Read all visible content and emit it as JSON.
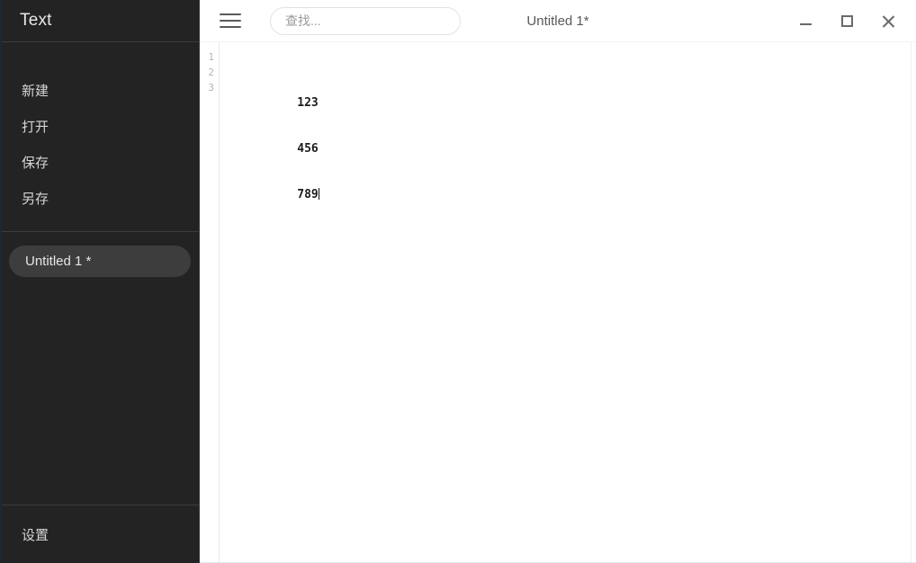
{
  "sidebar": {
    "app_title": "Text",
    "menu_items": [
      {
        "label": "新建",
        "name": "menu-item-new"
      },
      {
        "label": "打开",
        "name": "menu-item-open"
      },
      {
        "label": "保存",
        "name": "menu-item-save"
      },
      {
        "label": "另存",
        "name": "menu-item-save-as"
      }
    ],
    "tabs": [
      {
        "label": "Untitled 1 *",
        "active": true
      }
    ],
    "settings_label": "设置",
    "colors": {
      "background": "#232323",
      "divider": "#3c3c3c",
      "active_tab_background": "#3d3d3d",
      "text": "#d6d6d6"
    }
  },
  "topbar": {
    "menu_icon": "hamburger-icon",
    "search": {
      "placeholder": "查找...",
      "value": ""
    },
    "window_title": "Untitled 1*",
    "window_controls": [
      {
        "name": "minimize-button",
        "icon": "minimize-icon",
        "label": "—"
      },
      {
        "name": "maximize-button",
        "icon": "maximize-icon",
        "label": "□"
      },
      {
        "name": "close-button",
        "icon": "close-icon",
        "label": "✕"
      }
    ]
  },
  "editor": {
    "line_numbers": [
      "1",
      "2",
      "3"
    ],
    "lines": [
      "123",
      "456",
      "789"
    ],
    "cursor_line": 3,
    "cursor_column": 4,
    "colors": {
      "background": "#ffffff",
      "gutter_text": "#b4b4b4",
      "text": "#1c1c1c"
    }
  }
}
